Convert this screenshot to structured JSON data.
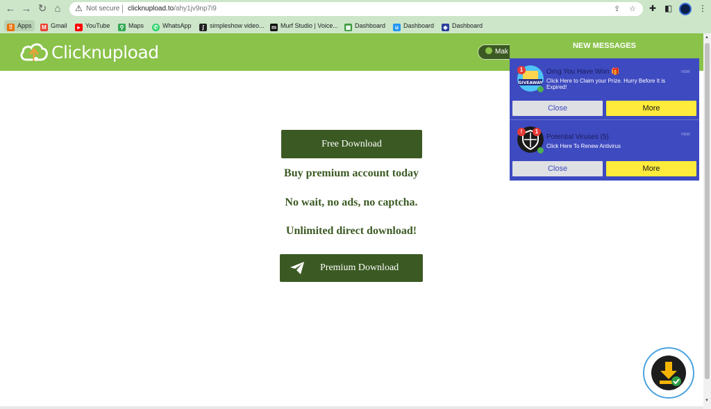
{
  "browser": {
    "security_label": "Not secure",
    "url_domain": "clicknupload.to",
    "url_path": "/ahy1jv9np7i9",
    "bookmarks": [
      {
        "label": "Apps",
        "icon": "apps-grid-icon",
        "color": "#e8710a"
      },
      {
        "label": "Gmail",
        "icon": "gmail-icon",
        "color": "#ea4335"
      },
      {
        "label": "YouTube",
        "icon": "youtube-icon",
        "color": "#ff0000"
      },
      {
        "label": "Maps",
        "icon": "maps-pin-icon",
        "color": "#34a853"
      },
      {
        "label": "WhatsApp",
        "icon": "whatsapp-icon",
        "color": "#25d366"
      },
      {
        "label": "simpleshow video...",
        "icon": "simpleshow-icon",
        "color": "#222222"
      },
      {
        "label": "Murf Studio | Voice...",
        "icon": "murf-icon",
        "color": "#111111"
      },
      {
        "label": "Dashboard",
        "icon": "dashboard-icon",
        "color": "#3c9a3c"
      },
      {
        "label": "Dashboard",
        "icon": "dashboard-u-icon",
        "color": "#2196f3"
      },
      {
        "label": "Dashboard",
        "icon": "dashboard-shield-icon",
        "color": "#2a3f9c"
      }
    ]
  },
  "site": {
    "logo_text": "Clicknupload",
    "header_button_label": "Mak",
    "free_download_label": "Free Download",
    "promo_lines": [
      "Buy premium account today",
      "No wait, no ads, no captcha.",
      "Unlimited direct download!"
    ],
    "premium_download_label": "Premium Download"
  },
  "notifications": {
    "header": "NEW MESSAGES",
    "items": [
      {
        "title": "Omg You Have Won 🎁",
        "description": "Click Here to Claim your Prize. Hurry Before It is Expired!",
        "time": "now",
        "badge": "1",
        "image_icon": "giveaway-icon",
        "image_text": "GIVEAWAY",
        "close_label": "Close",
        "more_label": "More"
      },
      {
        "title": "Potential Viruses (5)",
        "description": "Click Here To Renew Antivirus",
        "time": "now",
        "badge": "1",
        "image_icon": "shield-icon",
        "close_label": "Close",
        "more_label": "More"
      }
    ]
  },
  "colors": {
    "brand_green": "#8ac24a",
    "dark_green": "#3b5a23",
    "notif_blue": "#3e4ac0",
    "more_yellow": "#ffeb3b"
  }
}
